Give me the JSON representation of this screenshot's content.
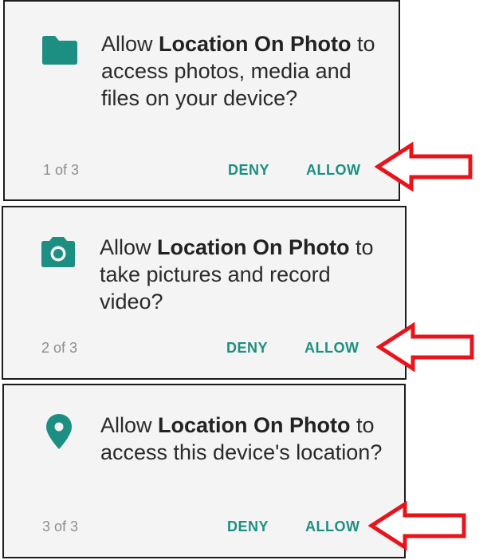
{
  "colors": {
    "accent": "#1c8f82",
    "dialog_background": "#f4f4f4",
    "counter_text": "#8e8e8e",
    "arrow": "#e8141b"
  },
  "dialogs": [
    {
      "icon": "folder-icon",
      "message": {
        "prefix": "Allow ",
        "app_name": "Location On Photo",
        "suffix": " to access photos, media and files on your device?"
      },
      "counter": "1 of 3",
      "deny_label": "DENY",
      "allow_label": "ALLOW"
    },
    {
      "icon": "camera-icon",
      "message": {
        "prefix": "Allow ",
        "app_name": "Location On Photo",
        "suffix": " to take pictures and record video?"
      },
      "counter": "2 of 3",
      "deny_label": "DENY",
      "allow_label": "ALLOW"
    },
    {
      "icon": "location-pin-icon",
      "message": {
        "prefix": "Allow ",
        "app_name": "Location On Photo",
        "suffix": " to access this device's location?"
      },
      "counter": "3 of 3",
      "deny_label": "DENY",
      "allow_label": "ALLOW"
    }
  ],
  "annotations": {
    "arrow_icon": "red-outline-left-arrow-icon"
  }
}
